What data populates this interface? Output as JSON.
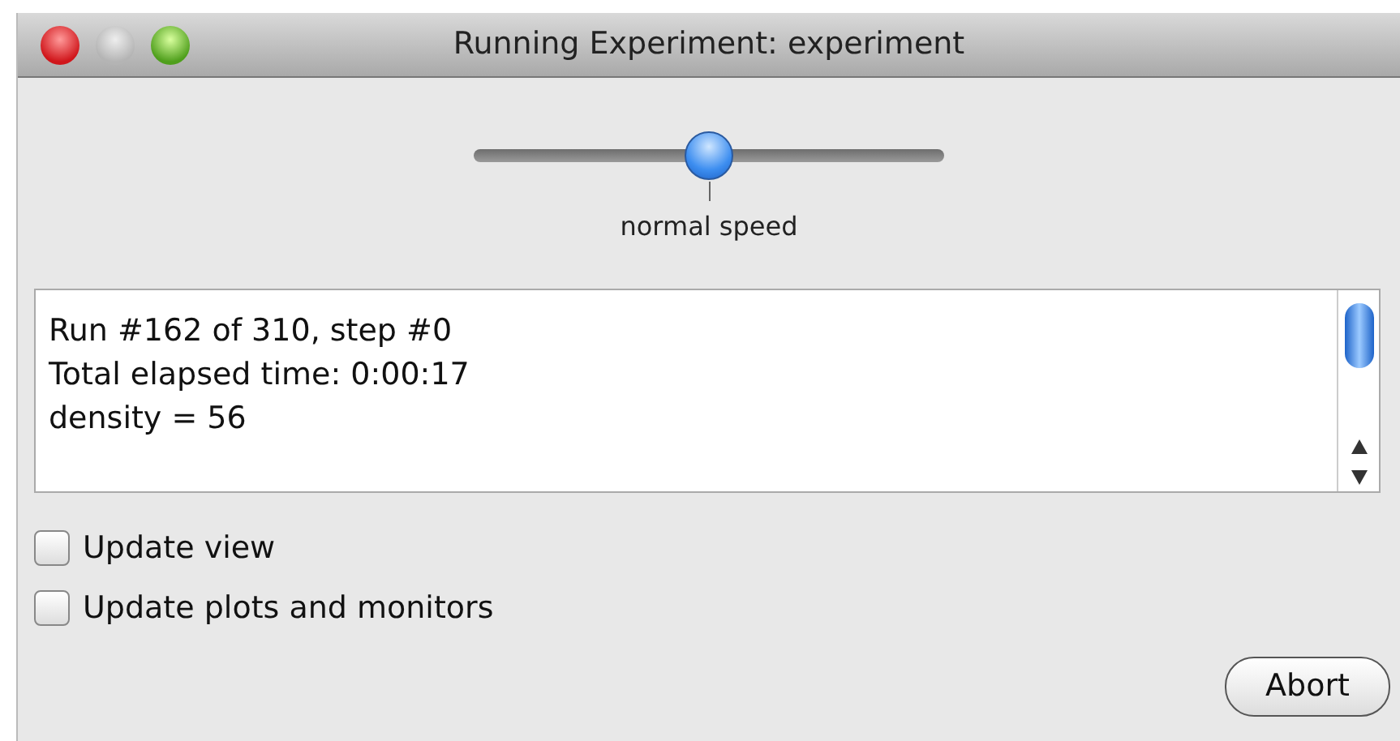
{
  "window": {
    "title": "Running Experiment: experiment"
  },
  "speed_slider": {
    "level": 0.5,
    "label": "normal speed"
  },
  "output": {
    "lines": [
      "Run #162 of 310, step #0",
      "Total elapsed time: 0:00:17",
      "density = 56"
    ]
  },
  "options": [
    {
      "label": "Update view",
      "checked": false
    },
    {
      "label": "Update plots and monitors",
      "checked": false
    }
  ],
  "buttons": [
    {
      "label": "Abort"
    }
  ]
}
